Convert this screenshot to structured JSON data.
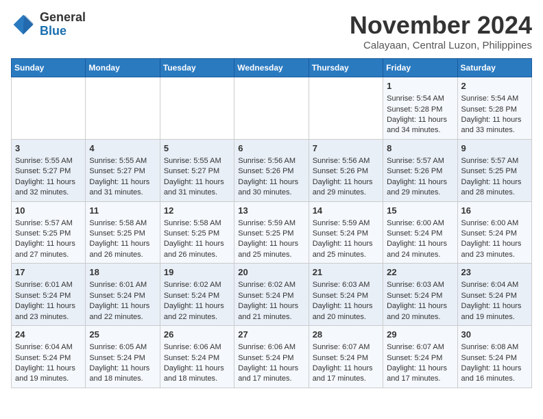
{
  "header": {
    "logo_line1": "General",
    "logo_line2": "Blue",
    "month": "November 2024",
    "location": "Calayaan, Central Luzon, Philippines"
  },
  "days_of_week": [
    "Sunday",
    "Monday",
    "Tuesday",
    "Wednesday",
    "Thursday",
    "Friday",
    "Saturday"
  ],
  "weeks": [
    [
      {
        "day": "",
        "info": ""
      },
      {
        "day": "",
        "info": ""
      },
      {
        "day": "",
        "info": ""
      },
      {
        "day": "",
        "info": ""
      },
      {
        "day": "",
        "info": ""
      },
      {
        "day": "1",
        "info": "Sunrise: 5:54 AM\nSunset: 5:28 PM\nDaylight: 11 hours and 34 minutes."
      },
      {
        "day": "2",
        "info": "Sunrise: 5:54 AM\nSunset: 5:28 PM\nDaylight: 11 hours and 33 minutes."
      }
    ],
    [
      {
        "day": "3",
        "info": "Sunrise: 5:55 AM\nSunset: 5:27 PM\nDaylight: 11 hours and 32 minutes."
      },
      {
        "day": "4",
        "info": "Sunrise: 5:55 AM\nSunset: 5:27 PM\nDaylight: 11 hours and 31 minutes."
      },
      {
        "day": "5",
        "info": "Sunrise: 5:55 AM\nSunset: 5:27 PM\nDaylight: 11 hours and 31 minutes."
      },
      {
        "day": "6",
        "info": "Sunrise: 5:56 AM\nSunset: 5:26 PM\nDaylight: 11 hours and 30 minutes."
      },
      {
        "day": "7",
        "info": "Sunrise: 5:56 AM\nSunset: 5:26 PM\nDaylight: 11 hours and 29 minutes."
      },
      {
        "day": "8",
        "info": "Sunrise: 5:57 AM\nSunset: 5:26 PM\nDaylight: 11 hours and 29 minutes."
      },
      {
        "day": "9",
        "info": "Sunrise: 5:57 AM\nSunset: 5:25 PM\nDaylight: 11 hours and 28 minutes."
      }
    ],
    [
      {
        "day": "10",
        "info": "Sunrise: 5:57 AM\nSunset: 5:25 PM\nDaylight: 11 hours and 27 minutes."
      },
      {
        "day": "11",
        "info": "Sunrise: 5:58 AM\nSunset: 5:25 PM\nDaylight: 11 hours and 26 minutes."
      },
      {
        "day": "12",
        "info": "Sunrise: 5:58 AM\nSunset: 5:25 PM\nDaylight: 11 hours and 26 minutes."
      },
      {
        "day": "13",
        "info": "Sunrise: 5:59 AM\nSunset: 5:25 PM\nDaylight: 11 hours and 25 minutes."
      },
      {
        "day": "14",
        "info": "Sunrise: 5:59 AM\nSunset: 5:24 PM\nDaylight: 11 hours and 25 minutes."
      },
      {
        "day": "15",
        "info": "Sunrise: 6:00 AM\nSunset: 5:24 PM\nDaylight: 11 hours and 24 minutes."
      },
      {
        "day": "16",
        "info": "Sunrise: 6:00 AM\nSunset: 5:24 PM\nDaylight: 11 hours and 23 minutes."
      }
    ],
    [
      {
        "day": "17",
        "info": "Sunrise: 6:01 AM\nSunset: 5:24 PM\nDaylight: 11 hours and 23 minutes."
      },
      {
        "day": "18",
        "info": "Sunrise: 6:01 AM\nSunset: 5:24 PM\nDaylight: 11 hours and 22 minutes."
      },
      {
        "day": "19",
        "info": "Sunrise: 6:02 AM\nSunset: 5:24 PM\nDaylight: 11 hours and 22 minutes."
      },
      {
        "day": "20",
        "info": "Sunrise: 6:02 AM\nSunset: 5:24 PM\nDaylight: 11 hours and 21 minutes."
      },
      {
        "day": "21",
        "info": "Sunrise: 6:03 AM\nSunset: 5:24 PM\nDaylight: 11 hours and 20 minutes."
      },
      {
        "day": "22",
        "info": "Sunrise: 6:03 AM\nSunset: 5:24 PM\nDaylight: 11 hours and 20 minutes."
      },
      {
        "day": "23",
        "info": "Sunrise: 6:04 AM\nSunset: 5:24 PM\nDaylight: 11 hours and 19 minutes."
      }
    ],
    [
      {
        "day": "24",
        "info": "Sunrise: 6:04 AM\nSunset: 5:24 PM\nDaylight: 11 hours and 19 minutes."
      },
      {
        "day": "25",
        "info": "Sunrise: 6:05 AM\nSunset: 5:24 PM\nDaylight: 11 hours and 18 minutes."
      },
      {
        "day": "26",
        "info": "Sunrise: 6:06 AM\nSunset: 5:24 PM\nDaylight: 11 hours and 18 minutes."
      },
      {
        "day": "27",
        "info": "Sunrise: 6:06 AM\nSunset: 5:24 PM\nDaylight: 11 hours and 17 minutes."
      },
      {
        "day": "28",
        "info": "Sunrise: 6:07 AM\nSunset: 5:24 PM\nDaylight: 11 hours and 17 minutes."
      },
      {
        "day": "29",
        "info": "Sunrise: 6:07 AM\nSunset: 5:24 PM\nDaylight: 11 hours and 17 minutes."
      },
      {
        "day": "30",
        "info": "Sunrise: 6:08 AM\nSunset: 5:24 PM\nDaylight: 11 hours and 16 minutes."
      }
    ]
  ]
}
